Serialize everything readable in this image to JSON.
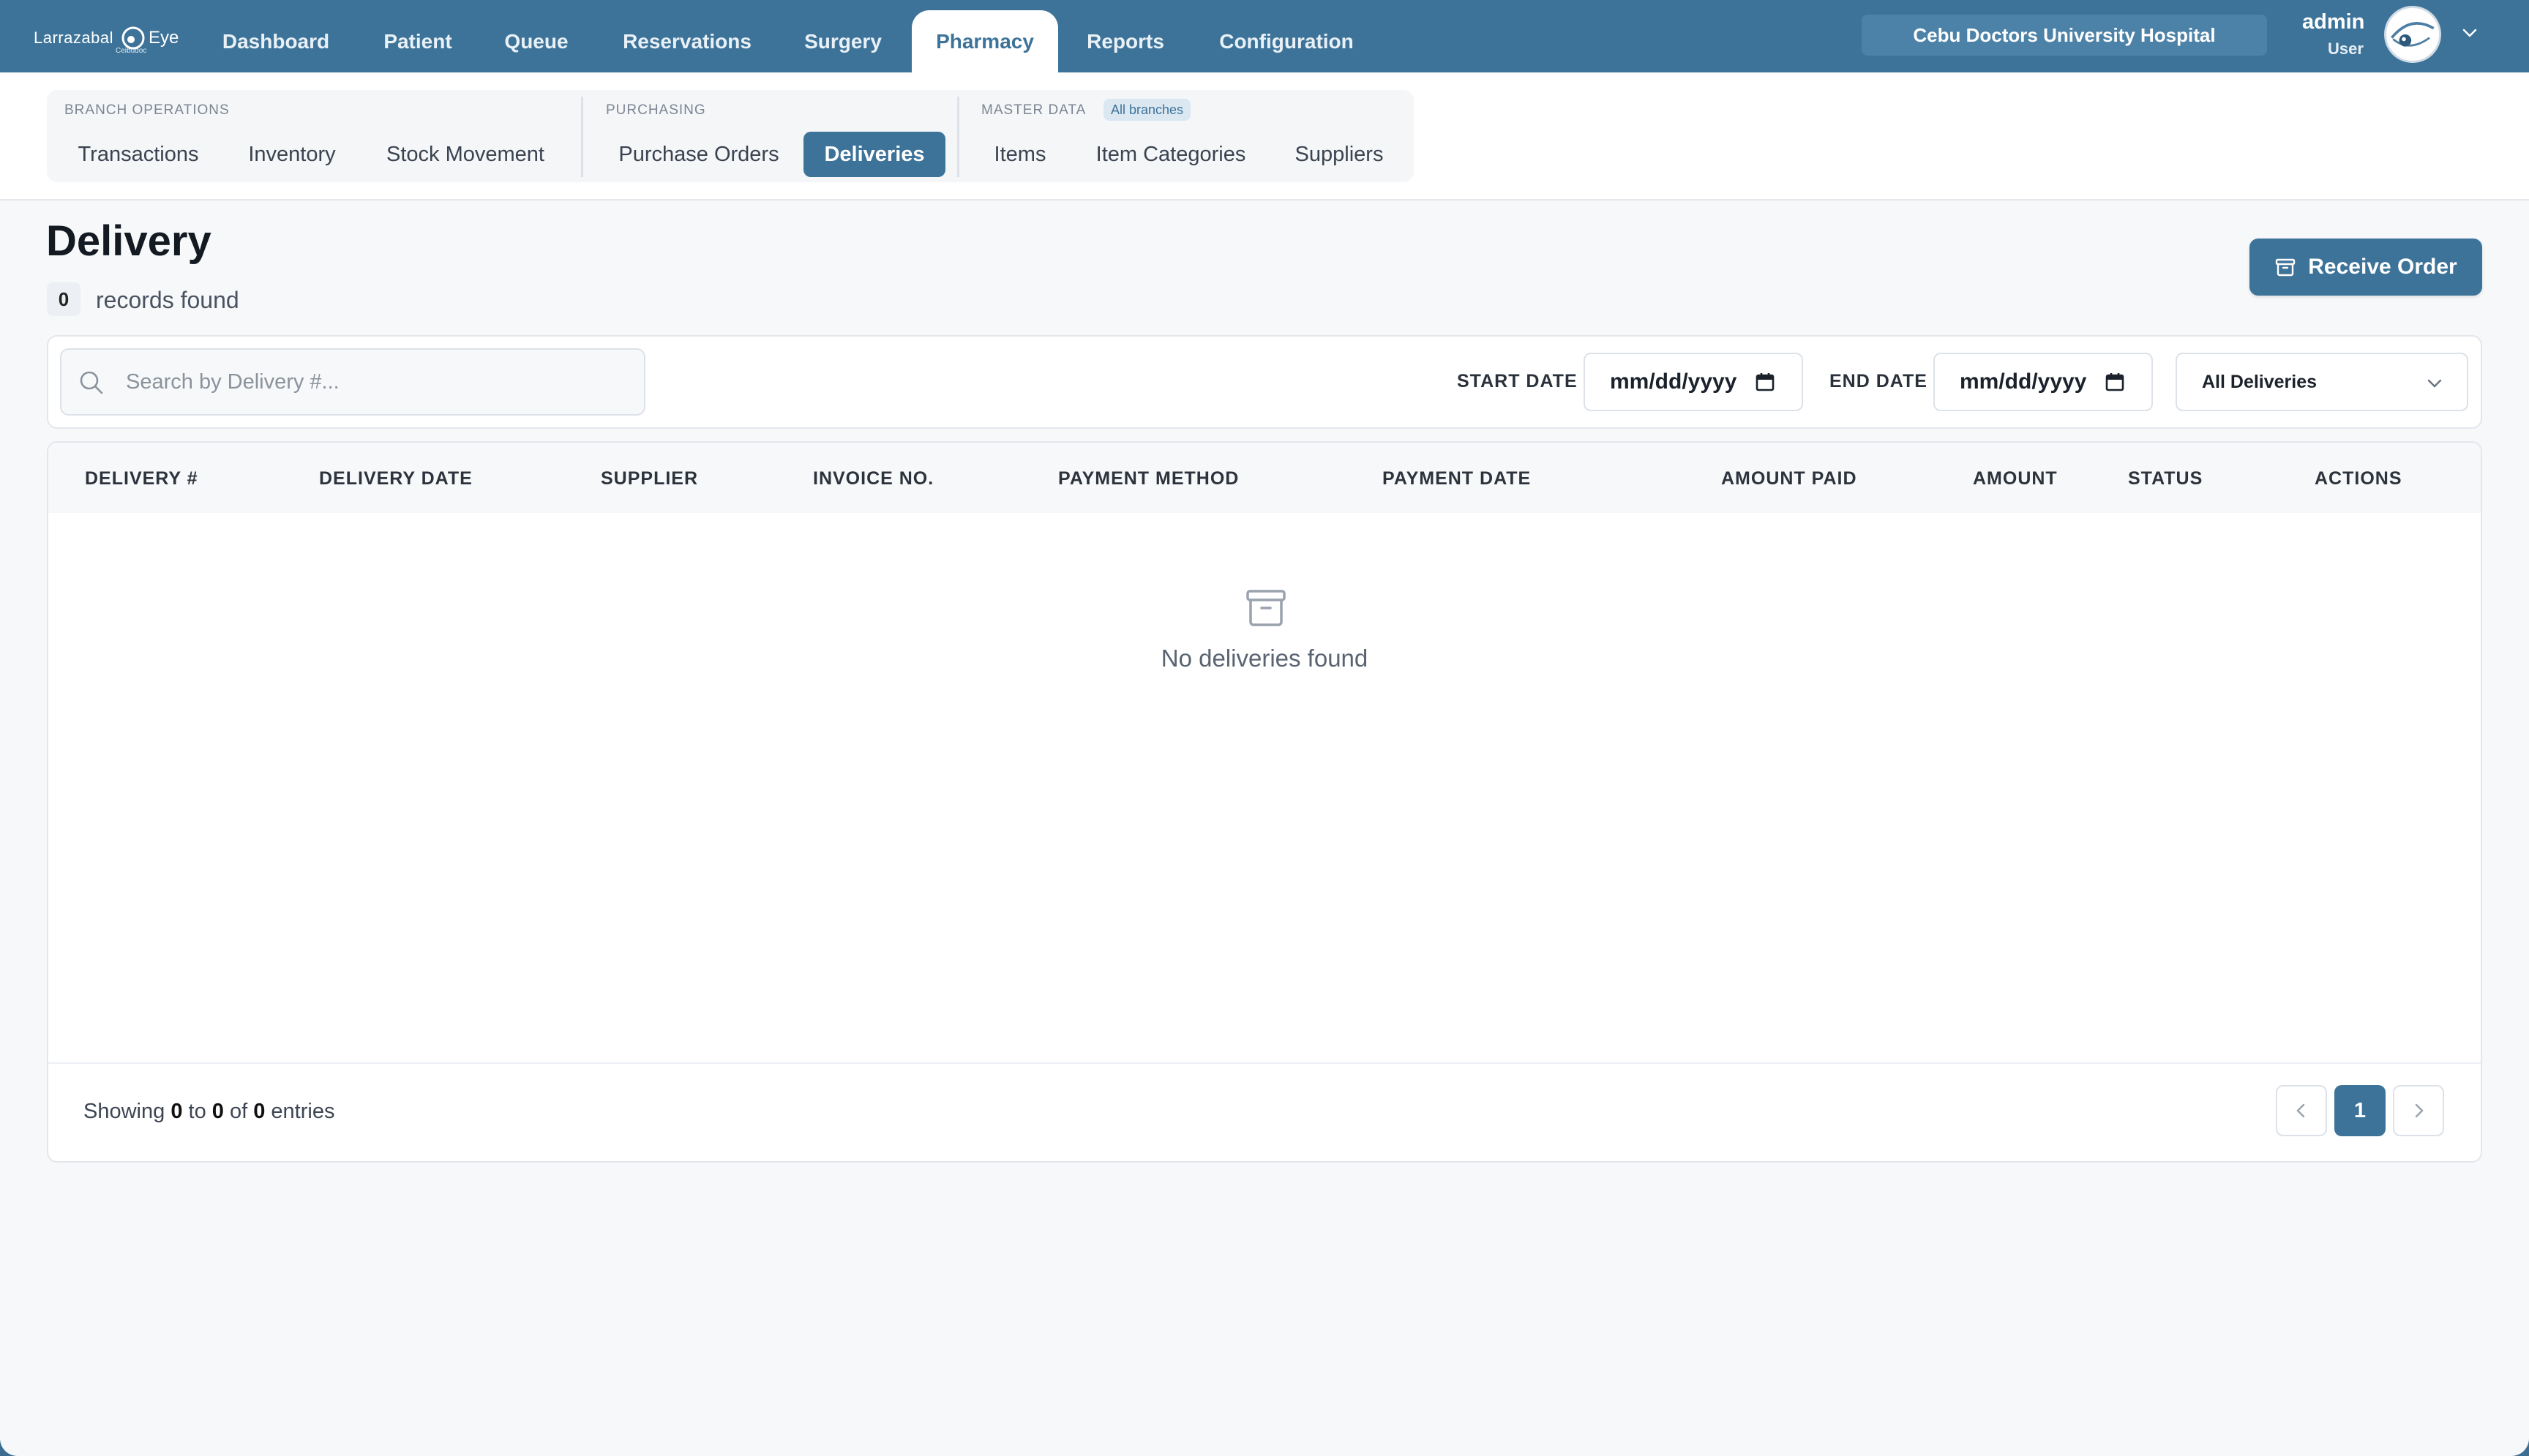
{
  "brand": {
    "name_left": "Larrazabal",
    "name_right": "Eye",
    "tagline": "Ceibudoc"
  },
  "nav": {
    "items": [
      "Dashboard",
      "Patient",
      "Queue",
      "Reservations",
      "Surgery",
      "Pharmacy",
      "Reports",
      "Configuration"
    ],
    "active": "Pharmacy"
  },
  "hospital": "Cebu Doctors University Hospital",
  "user": {
    "name": "admin",
    "role": "User"
  },
  "subnav": {
    "groups": {
      "branch": "BRANCH OPERATIONS",
      "purchasing": "PURCHASING",
      "master": "MASTER DATA",
      "master_badge": "All branches"
    },
    "items": [
      "Transactions",
      "Inventory",
      "Stock Movement",
      "Purchase Orders",
      "Deliveries",
      "Items",
      "Item Categories",
      "Suppliers"
    ],
    "active": "Deliveries"
  },
  "page": {
    "title": "Delivery",
    "count": "0",
    "count_label": "records found",
    "receive_label": "Receive Order"
  },
  "filters": {
    "search_placeholder": "Search by Delivery #...",
    "start_label": "START DATE",
    "end_label": "END DATE",
    "start_value": "mm/dd/yyyy",
    "end_value": "mm/dd/yyyy",
    "status_selected": "All Deliveries"
  },
  "table": {
    "columns": [
      "DELIVERY #",
      "DELIVERY DATE",
      "SUPPLIER",
      "INVOICE NO.",
      "PAYMENT METHOD",
      "PAYMENT DATE",
      "AMOUNT PAID",
      "AMOUNT",
      "STATUS",
      "ACTIONS"
    ],
    "empty_text": "No deliveries found"
  },
  "pagination": {
    "showing": "Showing",
    "from": "0",
    "to_word": "to",
    "to": "0",
    "of_word": "of",
    "total": "0",
    "entries": "entries",
    "current_page": "1"
  },
  "colors": {
    "primary": "#3d7399",
    "background": "#f6f8fa"
  }
}
